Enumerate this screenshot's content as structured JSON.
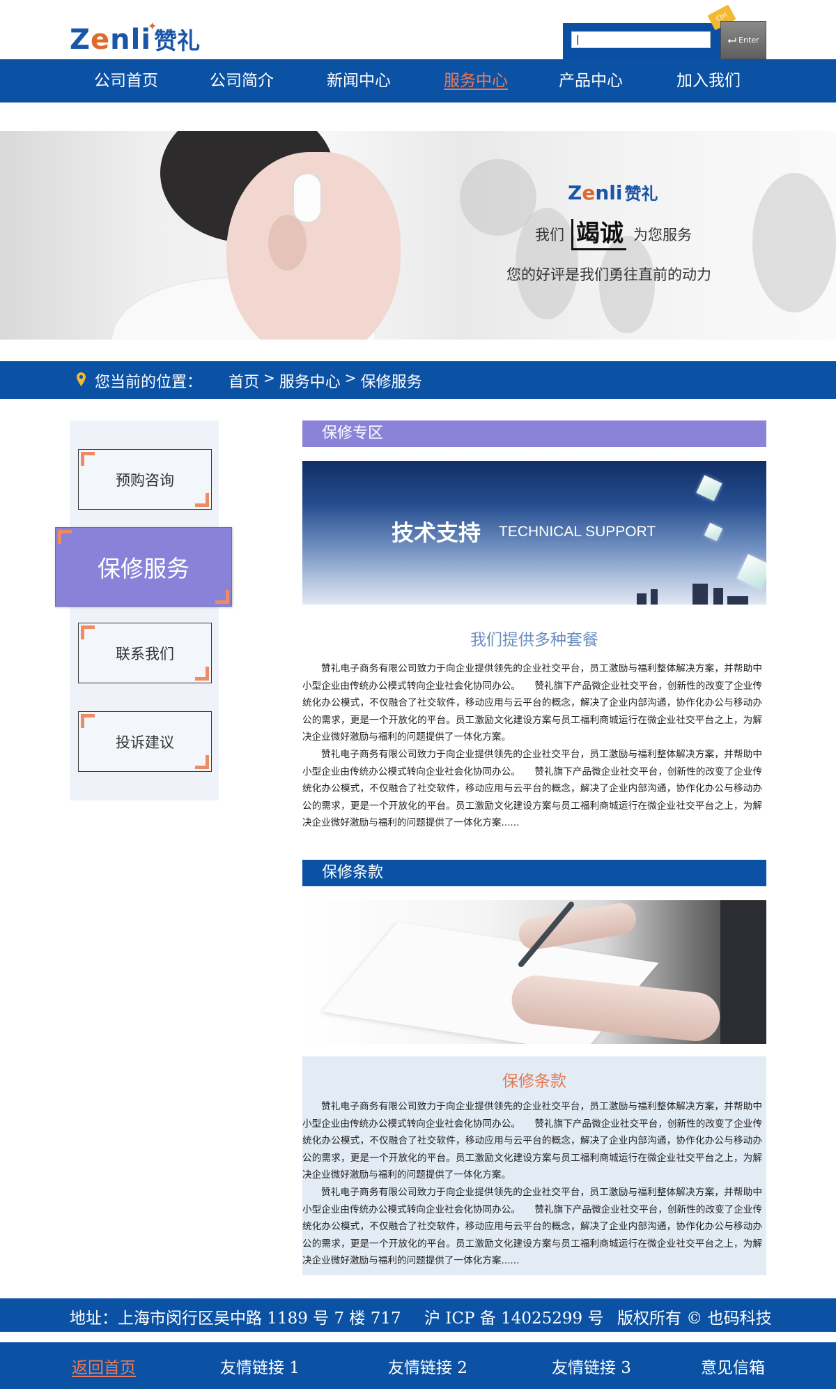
{
  "header": {
    "logo_en_pre": "Z",
    "logo_en_o": "e",
    "logo_en_post": "nli",
    "logo_cn": "赞礼",
    "search_value": "|",
    "ctrl_label": "Ctrl",
    "enter_label": "Enter"
  },
  "nav": {
    "items": [
      "公司首页",
      "公司简介",
      "新闻中心",
      "服务中心",
      "产品中心",
      "加入我们"
    ],
    "active_index": 3
  },
  "banner": {
    "logo_en_pre": "Z",
    "logo_en_o": "e",
    "logo_en_post": "nli",
    "logo_cn": "赞礼",
    "line1_pre": "我们",
    "line1_big": "竭诚",
    "line1_post": "为您服务",
    "line2": "您的好评是我们勇往直前的动力"
  },
  "breadcrumb": {
    "label": "您当前的位置：",
    "path": [
      "首页",
      "服务中心",
      "保修服务"
    ],
    "separator": ">"
  },
  "sidebar": {
    "items": [
      "预购咨询",
      "保修服务",
      "联系我们",
      "投诉建议"
    ],
    "active_index": 1
  },
  "section1": {
    "header": "保修专区",
    "image_title": "技术支持",
    "image_subtitle": "TECHNICAL SUPPORT",
    "title": "我们提供多种套餐",
    "paragraphs": [
      "赞礼电子商务有限公司致力于向企业提供领先的企业社交平台，员工激励与福利整体解决方案，并帮助中小型企业由传统办公模式转向企业社会化协同办公。　　赞礼旗下产品微企业社交平台，创新性的改变了企业传统化办公模式，不仅融合了社交软件，移动应用与云平台的概念，解决了企业内部沟通，协作化办公与移动办公的需求，更是一个开放化的平台。员工激励文化建设方案与员工福利商城运行在微企业社交平台之上，为解决企业微好激励与福利的问题提供了一体化方案。",
      "赞礼电子商务有限公司致力于向企业提供领先的企业社交平台，员工激励与福利整体解决方案，并帮助中小型企业由传统办公模式转向企业社会化协同办公。　　赞礼旗下产品微企业社交平台，创新性的改变了企业传统化办公模式，不仅融合了社交软件，移动应用与云平台的概念，解决了企业内部沟通，协作化办公与移动办公的需求，更是一个开放化的平台。员工激励文化建设方案与员工福利商城运行在微企业社交平台之上，为解决企业微好激励与福利的问题提供了一体化方案......"
    ]
  },
  "section2": {
    "header": "保修条款",
    "title": "保修条款",
    "paragraphs": [
      "赞礼电子商务有限公司致力于向企业提供领先的企业社交平台，员工激励与福利整体解决方案，并帮助中小型企业由传统办公模式转向企业社会化协同办公。　　赞礼旗下产品微企业社交平台，创新性的改变了企业传统化办公模式，不仅融合了社交软件，移动应用与云平台的概念，解决了企业内部沟通，协作化办公与移动办公的需求，更是一个开放化的平台。员工激励文化建设方案与员工福利商城运行在微企业社交平台之上，为解决企业微好激励与福利的问题提供了一体化方案。",
      "赞礼电子商务有限公司致力于向企业提供领先的企业社交平台，员工激励与福利整体解决方案，并帮助中小型企业由传统办公模式转向企业社会化协同办公。　　赞礼旗下产品微企业社交平台，创新性的改变了企业传统化办公模式，不仅融合了社交软件，移动应用与云平台的概念，解决了企业内部沟通，协作化办公与移动办公的需求，更是一个开放化的平台。员工激励文化建设方案与员工福利商城运行在微企业社交平台之上，为解决企业微好激励与福利的问题提供了一体化方案......"
    ]
  },
  "footer": {
    "address": "地址：上海市闵行区吴中路 1189 号 7 楼 717",
    "icp": "沪 ICP 备 14025299 号",
    "copyright": "版权所有 © 也码科技",
    "links": [
      "返回首页",
      "友情链接 1",
      "友情链接 2",
      "友情链接 3",
      "意见信箱"
    ],
    "active_link_index": 0
  },
  "colors": {
    "primary_blue": "#0b52a5",
    "accent_purple": "#8a83d8",
    "accent_orange": "#f07a55",
    "logo_orange": "#e06a2c",
    "sidebar_bg": "#eff3f9",
    "terms_bg": "#e3ebf5"
  },
  "icons": [
    "location-pin-icon",
    "enter-arrow-icon"
  ]
}
